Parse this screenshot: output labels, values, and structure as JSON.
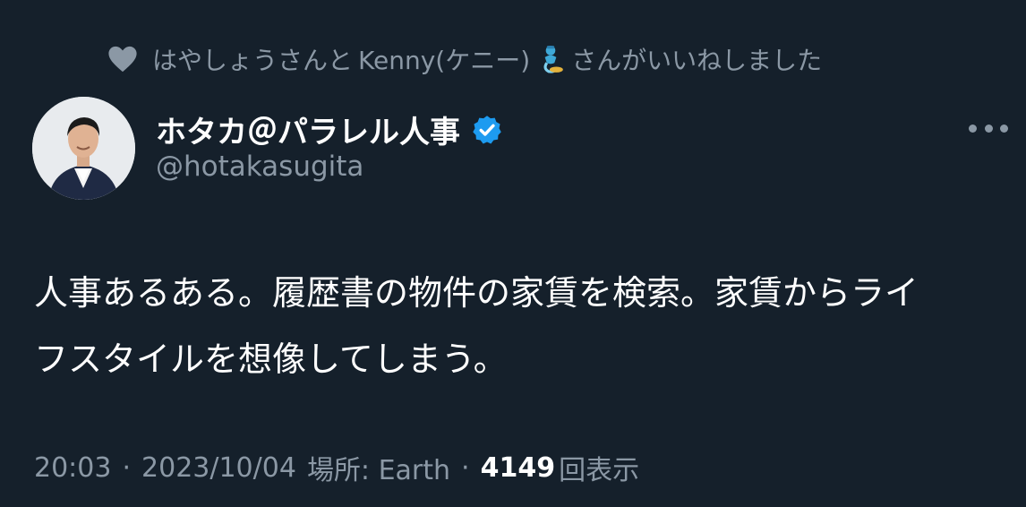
{
  "social_context": {
    "prefix": "はやしょうさんと",
    "second_liker": "Kenny(ケニー)",
    "suffix": "さんがいいねしました",
    "emoji_icon": "genie-emoji-icon",
    "icon": "heart-icon"
  },
  "author": {
    "display_name": "ホタカ＠パラレル人事",
    "handle": "@hotakasugita",
    "verified_icon": "verified-badge-icon",
    "verified_color": "#1d9bf0"
  },
  "tweet": {
    "lines": [
      "人事あるある。履歴書の物件の家賃を検索。家賃からライ",
      "フスタイルを想像してしまう。"
    ]
  },
  "meta": {
    "time": "20:03",
    "date": "2023/10/04",
    "location_label": "場所: Earth",
    "separator": "·",
    "views_count": "4149",
    "views_label": "回表示"
  },
  "colors": {
    "background": "#15202b",
    "primary_text": "#ffffff",
    "secondary_text": "#8b98a5",
    "accent": "#1d9bf0"
  }
}
